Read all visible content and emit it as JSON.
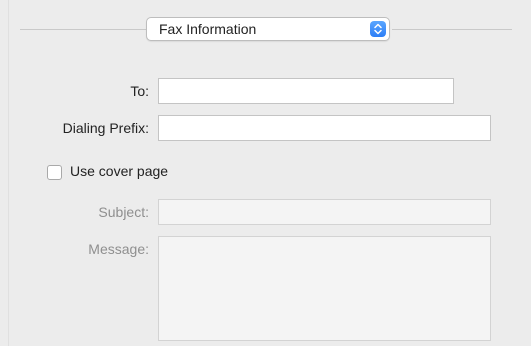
{
  "popup": {
    "selected": "Fax Information"
  },
  "fields": {
    "to_label": "To:",
    "to_value": "",
    "prefix_label": "Dialing Prefix:",
    "prefix_value": "",
    "cover_page_label": "Use cover page",
    "cover_page_checked": false,
    "subject_label": "Subject:",
    "subject_value": "",
    "message_label": "Message:",
    "message_value": ""
  },
  "colors": {
    "background": "#ececec",
    "accent": "#2d7ef6"
  }
}
